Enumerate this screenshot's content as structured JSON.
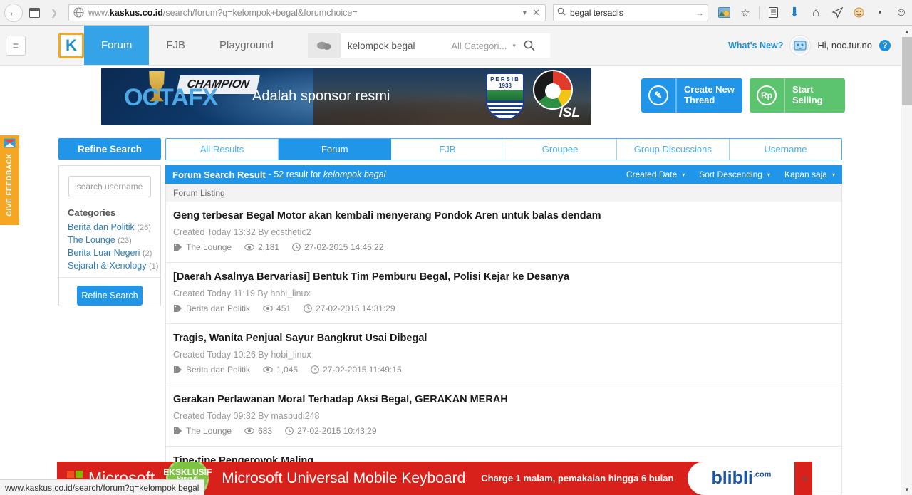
{
  "browser": {
    "back_icon": "back-arrow-icon",
    "url": {
      "prefix": "www.",
      "domain": "kaskus.co.id",
      "path": "/search/forum?q=kelompok+begal&forumchoice="
    },
    "search_value": "begal tersadis",
    "toolbar_icons": [
      "photo-icon",
      "star-icon",
      "reading-list-icon",
      "download-icon",
      "home-icon",
      "send-icon",
      "adblock-icon",
      "dropdown-caret-icon",
      "smiley-icon",
      "menu-icon"
    ]
  },
  "header": {
    "hamburger": "≡",
    "logo_letter": "K",
    "nav": [
      {
        "label": "Forum",
        "active": true
      },
      {
        "label": "FJB",
        "active": false
      },
      {
        "label": "Playground",
        "active": false
      }
    ],
    "search": {
      "query": "kelompok begal",
      "category": "All Categori...",
      "placeholder": "Search"
    },
    "whats_new": "What's New?",
    "greeting": "Hi, noc.tur.no",
    "help": "?"
  },
  "banner": {
    "brand_1": "OCTA",
    "brand_2": "FX",
    "tagline": "Adalah sponsor resmi",
    "champion_text": "CHAMPION",
    "persib_line1": "PERSIB",
    "persib_line2": "1933",
    "isl_text": "ISL",
    "create_thread": "Create New\nThread",
    "create_thread_line1": "Create New",
    "create_thread_line2": "Thread",
    "start_selling": "Start Selling",
    "rp_symbol": "Rp",
    "pencil": "✎"
  },
  "feedback": {
    "label": "GIVE FEEDBACK",
    "icon": "envelope-icon"
  },
  "content": {
    "refine_button": "Refine Search",
    "tabs": [
      {
        "label": "All Results",
        "active": false
      },
      {
        "label": "Forum",
        "active": true
      },
      {
        "label": "FJB",
        "active": false
      },
      {
        "label": "Groupee",
        "active": false
      },
      {
        "label": "Group Discussions",
        "active": false
      },
      {
        "label": "Username",
        "active": false
      }
    ],
    "sidebar": {
      "username_placeholder": "search username",
      "categories_title": "Categories",
      "categories": [
        {
          "label": "Berita dan Politik",
          "count": "(26)"
        },
        {
          "label": "The Lounge",
          "count": "(23)"
        },
        {
          "label": "Berita Luar Negeri",
          "count": "(2)"
        },
        {
          "label": "Sejarah & Xenology",
          "count": "(1)"
        }
      ],
      "refine_button": "Refine Search"
    },
    "results_header": {
      "title": "Forum Search Result",
      "count_prefix": "- 52 result for",
      "query": "kelompok begal",
      "sorts": [
        {
          "label": "Created Date"
        },
        {
          "label": "Sort Descending"
        },
        {
          "label": "Kapan saja"
        }
      ]
    },
    "listing_label": "Forum Listing",
    "results": [
      {
        "title": "Geng terbesar Begal Motor akan kembali menyerang Pondok Aren untuk balas dendam",
        "created": "Created Today 13:32 By ecsthetic2",
        "category": "The Lounge",
        "views": "2,181",
        "date": "27-02-2015 14:45:22"
      },
      {
        "title": "[Daerah Asalnya Bervariasi] Bentuk Tim Pemburu Begal, Polisi Kejar ke Desanya",
        "created": "Created Today 11:19 By hobi_linux",
        "category": "Berita dan Politik",
        "views": "451",
        "date": "27-02-2015 14:31:29"
      },
      {
        "title": "Tragis, Wanita Penjual Sayur Bangkrut Usai Dibegal",
        "created": "Created Today 10:26 By hobi_linux",
        "category": "Berita dan Politik",
        "views": "1,045",
        "date": "27-02-2015 11:49:15"
      },
      {
        "title": "Gerakan Perlawanan Moral Terhadap Aksi Begal, GERAKAN MERAH",
        "created": "Created Today 09:32 By masbudi248",
        "category": "The Lounge",
        "views": "683",
        "date": "27-02-2015 10:43:29"
      },
      {
        "title": "Tipe-tipe Pengeroyok Maling",
        "created": "",
        "category": "",
        "views": "",
        "date": ""
      }
    ]
  },
  "bottom_ad": {
    "brand": "Microsoft",
    "badge_line1": "EKSKLUSIF",
    "badge_line2": "Hanya di",
    "badge_line3": "blibli.com",
    "headline": "Microsoft Universal Mobile Keyboard",
    "subline": "Charge 1 malam, pemakaian hingga 6 bulan",
    "store": "blibli",
    "store_sup": ".com",
    "collapse": "«"
  },
  "status_bar": {
    "url": "www.kaskus.co.id/search/forum?q=kelompok begal"
  },
  "colors": {
    "accent_blue": "#2196e8",
    "tab_blue": "#34a3e8",
    "green": "#5cc46e",
    "orange": "#f5a623",
    "ad_red": "#d8211a"
  }
}
